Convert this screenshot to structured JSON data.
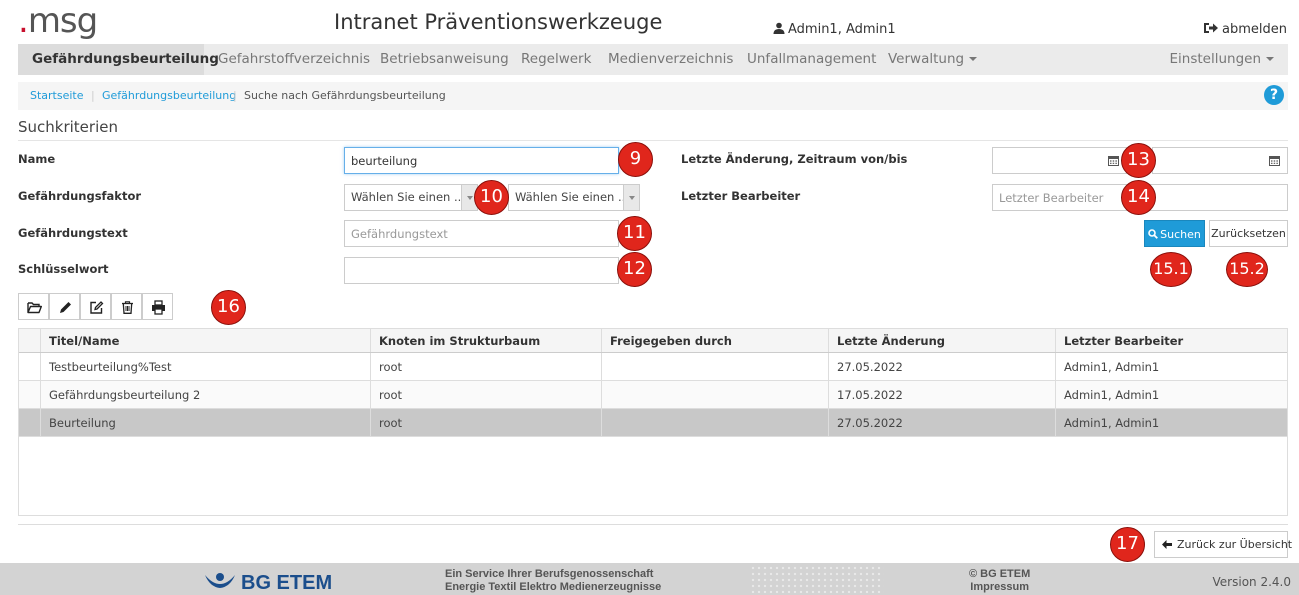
{
  "header": {
    "logo_text": "msg",
    "app_title": "Intranet Präventionswerkzeuge",
    "user_name": "Admin1, Admin1",
    "logout_label": "abmelden"
  },
  "nav": {
    "items": [
      {
        "label": "Gefährdungsbeurteilung",
        "active": true
      },
      {
        "label": "Gefahrstoffverzeichnis"
      },
      {
        "label": "Betriebsanweisung"
      },
      {
        "label": "Regelwerk"
      },
      {
        "label": "Medienverzeichnis"
      },
      {
        "label": "Unfallmanagement"
      },
      {
        "label": "Verwaltung",
        "dropdown": true
      }
    ],
    "settings_label": "Einstellungen"
  },
  "breadcrumb": {
    "home": "Startseite",
    "parent": "Gefährdungsbeurteilung",
    "current": "Suche nach Gefährdungsbeurteilung",
    "sep": "|"
  },
  "search": {
    "section_title": "Suchkriterien",
    "name_label": "Name",
    "name_value": "beurteilung",
    "faktor_label": "Gefährdungsfaktor",
    "faktor_select1": "Wählen Sie einen ...",
    "faktor_select2": "Wählen Sie einen ...",
    "text_label": "Gefährdungstext",
    "text_placeholder": "Gefährdungstext",
    "keyword_label": "Schlüsselwort",
    "keyword_value": "",
    "date_label": "Letzte Änderung, Zeitraum von/bis",
    "editor_label": "Letzter Bearbeiter",
    "editor_placeholder": "Letzter Bearbeiter",
    "search_button": "Suchen",
    "reset_button": "Zurücksetzen"
  },
  "badges": {
    "b9": "9",
    "b10": "10",
    "b11": "11",
    "b12": "12",
    "b13": "13",
    "b14": "14",
    "b151": "15.1",
    "b152": "15.2",
    "b16": "16",
    "b17": "17"
  },
  "table": {
    "columns": [
      "Titel/Name",
      "Knoten im Strukturbaum",
      "Freigegeben durch",
      "Letzte Änderung",
      "Letzter Bearbeiter"
    ],
    "rows": [
      [
        "Testbeurteilung%Test",
        "root",
        "",
        "27.05.2022",
        "Admin1, Admin1"
      ],
      [
        "Gefährdungsbeurteilung 2",
        "root",
        "",
        "17.05.2022",
        "Admin1, Admin1"
      ],
      [
        "Beurteilung",
        "root",
        "",
        "27.05.2022",
        "Admin1, Admin1"
      ]
    ],
    "selected_row": 2
  },
  "back_button": "Zurück zur Übersicht",
  "footer": {
    "logo_text": "BG ETEM",
    "service_line1": "Ein Service Ihrer Berufsgenossenschaft",
    "service_line2": "Energie Textil Elektro Medienerzeugnisse",
    "copyright": "© BG ETEM",
    "impressum": "Impressum",
    "version": "Version 2.4.0"
  },
  "colors": {
    "accent": "#1f9bd8",
    "badge": "#e0261c",
    "brand_red": "#c8102e",
    "footer_logo": "#1b4e8c"
  }
}
